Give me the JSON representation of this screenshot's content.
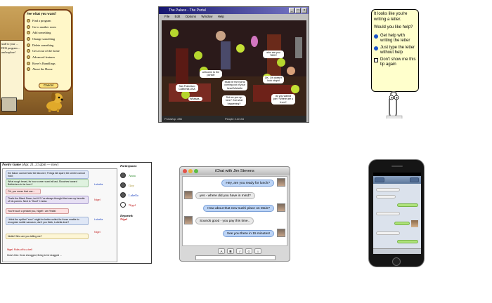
{
  "bob": {
    "menu_title": "See what you want?",
    "items": [
      "Find a program",
      "Go to another room",
      "Add something",
      "Change something",
      "Delete something",
      "Get a tour of the home",
      "Advanced features",
      "Rover's Ramblings",
      "About the Home"
    ],
    "cancel": "Cancel",
    "side_text": "stuff to your ... DOS program ... and explore!"
  },
  "palace": {
    "title": "The Palace - The Portal",
    "menus": [
      "File",
      "Edit",
      "Options",
      "Window",
      "Help"
    ],
    "bubbles": [
      "who are you 7800?",
      "welcome to the portal!!",
      "San Francisco California USA",
      "Must be the horns coming out of your head Michelle",
      "OK, Oh doesn't look stupid",
      "Did we you up here? Got what happening?",
      "Whaaaa...",
      "do you wanna join? Where are u from?"
    ],
    "status_left": "Portal/op: 286",
    "status_right": "People: 14/134"
  },
  "clippy": {
    "line1": "It looks like you're writing a letter.",
    "line2": "Would you like help?",
    "options": [
      "Get help with writing the letter",
      "Just type the letter without help"
    ],
    "checkbox_label": "Don't show me this tip again"
  },
  "poetry": {
    "header": "Poetry Game",
    "header_meta": "(Apr. 21, 2:52pm — now)",
    "participants_title": "Participants:",
    "participants": [
      "Anna",
      "Guy",
      "Lubella",
      "Nigel"
    ],
    "departed_title": "Departed:",
    "departed": "Nigel",
    "messages": [
      "the falcon cannot hear the falconer; Things fall apart, the centre cannot hold;",
      "What rough beast, its hour come round at last, Slouches toward Bethlehem to be born?",
      "Oh, you mean that one...",
      "That's the Black Swan, isn't it? I've always thought that one my favorite of his poems. Next is \"Howl\" I mean.",
      "You're such a pedant you, Nigel! I am Yeats!",
      "I think the epithet \"sour\" might be better suited for those unable to recognize subtle sarcasm, don't you think, Lubella dear?",
      "Nuttin! Who are you telling me?",
      "Nigel: Rolls off to a bell",
      "How's this: Crow shrugged, fixing to be dragged ..."
    ],
    "speakers": [
      "Lubella",
      "Nigel",
      "Lubella",
      "Nigel"
    ]
  },
  "ichat": {
    "title": "iChat with Jim Stevens",
    "messages": [
      {
        "text": "Hey, are you ready for lunch?",
        "side": "right",
        "style": "blue"
      },
      {
        "text": "yes - where did you have in mind?",
        "side": "left",
        "style": "grey"
      },
      {
        "text": "How about that new sushi place on Main?",
        "side": "right",
        "style": "blue"
      },
      {
        "text": "Sounds good - you pay this time..",
        "side": "left",
        "style": "grey"
      },
      {
        "text": "See you there in 15 minutes!",
        "side": "right",
        "style": "blue"
      }
    ],
    "format_buttons": [
      "A",
      "B",
      "I",
      "☺",
      "⌂"
    ]
  },
  "iphone": {
    "bubbles": [
      {
        "side": "left",
        "style": "grey"
      },
      {
        "side": "left",
        "style": "grey"
      },
      {
        "side": "right",
        "style": "green"
      },
      {
        "side": "left",
        "style": "grey"
      },
      {
        "side": "right",
        "style": "green"
      },
      {
        "side": "left",
        "style": "grey"
      },
      {
        "side": "right",
        "style": "green"
      }
    ]
  }
}
